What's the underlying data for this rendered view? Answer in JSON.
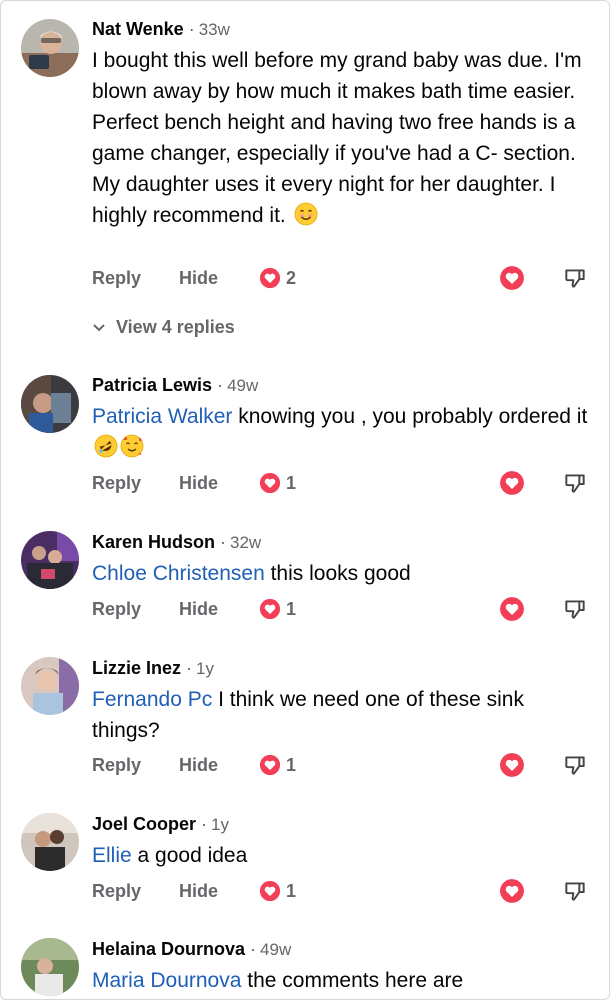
{
  "actions": {
    "reply": "Reply",
    "hide": "Hide"
  },
  "comments": [
    {
      "name": "Nat Wenke",
      "time": "33w",
      "mention": "",
      "text": "I bought this well before my grand baby was due. I'm blown away by how much it makes bath time easier. Perfect bench height and having two free hands is a game changer, especially if you've had a C- section. My daughter uses it every night for her daughter. I highly recommend it.",
      "emoji": "smiling-face",
      "likes": "2"
    },
    {
      "name": "Patricia Lewis",
      "time": "49w",
      "mention": "Patricia Walker",
      "text": " knowing you , you probably ordered it",
      "emoji": "rofl-and-hearts-faces",
      "likes": "1"
    },
    {
      "name": "Karen Hudson",
      "time": "32w",
      "mention": "Chloe Christensen",
      "text": " this looks good",
      "likes": "1"
    },
    {
      "name": "Lizzie Inez",
      "time": "1y",
      "mention": "Fernando Pc",
      "text": " I think we need one of these sink things?",
      "likes": "1"
    },
    {
      "name": "Joel Cooper",
      "time": "1y",
      "mention": "Ellie",
      "text": " a good idea",
      "likes": "1"
    },
    {
      "name": "Helaina Dournova",
      "time": "49w",
      "mention": "Maria Dournova",
      "text": " the comments here are"
    }
  ],
  "view_replies": "View 4 replies",
  "colors": {
    "like_red": "#f33e58",
    "mention_blue": "#1f5fb5",
    "meta_gray": "#65676b"
  },
  "icons": [
    "heart-icon",
    "thumbs-down-icon",
    "chevron-down-icon",
    "smiling-face-emoji",
    "rofl-emoji",
    "smiling-hearts-emoji"
  ]
}
